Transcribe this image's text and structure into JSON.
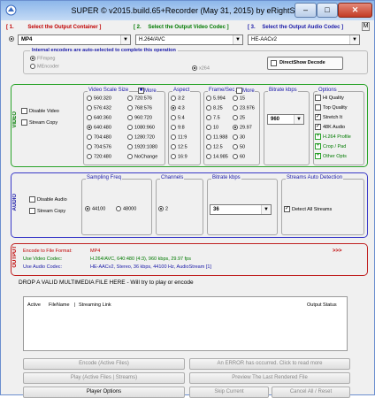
{
  "window": {
    "title": "SUPER © v2015.build.65+Recorder (May 31, 2015) by eRightSoft",
    "minimize": "–",
    "maximize": "□",
    "close": "✕",
    "m_label": "M"
  },
  "selectors": {
    "container_label": "[ 1.",
    "container_title": "Select the Output Container ]",
    "container_value": "MP4",
    "video_label": "[ 2.",
    "video_title": "Select the Output Video Codec ]",
    "video_value": "H.264/AVC",
    "audio_label": "[ 3.",
    "audio_title": "Select the Output Audio Codec ]",
    "audio_value": "HE-AACv2"
  },
  "encoders": {
    "note": "Internal encoders are auto-selected to complete this operation",
    "ffmpeg": "FFmpeg",
    "mencoder": "MEncoder",
    "x264": "x264",
    "directshow": "DirectShow Decode"
  },
  "video": {
    "section": "VIDEO",
    "disable_video": "Disable Video",
    "stream_copy": "Stream Copy",
    "scale_title": "Video Scale Size",
    "more": "More",
    "sizes_col1": [
      "560:320",
      "576:432",
      "640:360",
      "640:480",
      "704:480",
      "704:576",
      "720:480"
    ],
    "sizes_col2": [
      "720:576",
      "768:576",
      "960:720",
      "1080:960",
      "1280:720",
      "1920:1080",
      "NoChange"
    ],
    "aspect_title": "Aspect",
    "aspects": [
      "3:2",
      "4:3",
      "5:4",
      "9:8",
      "11:9",
      "12:5",
      "16:9"
    ],
    "frame_title": "Frame/Sec",
    "fps_col1": [
      "5.994",
      "8.25",
      "7.5",
      "10",
      "11.988",
      "12.5",
      "14.985"
    ],
    "fps_col2": [
      "15",
      "23.976",
      "25",
      "29.97",
      "30",
      "50",
      "60"
    ],
    "bitrate_title": "Bitrate  kbps",
    "bitrate_value": "960",
    "options_title": "Options",
    "options": [
      "Hi Quality",
      "Top Quality",
      "Stretch It",
      "48K Audio",
      "H.264 Profile",
      "Crop / Pad",
      "Other Opts"
    ]
  },
  "audio": {
    "section": "AUDIO",
    "disable_audio": "Disable Audio",
    "stream_copy": "Stream Copy",
    "sampling_title": "Sampling Freq",
    "freq1": "44100",
    "freq2": "48000",
    "channels_title": "Channels",
    "channel": "2",
    "bitrate_title": "Bitrate  kbps",
    "bitrate_value": "36",
    "detection_title": "Streams Auto Detection",
    "detect_all": "Detect All Streams"
  },
  "output": {
    "section": "OUTPUT",
    "line1_label": "Encode to File Format:",
    "line1_value": "MP4",
    "line2_label": "Use Video Codec:",
    "line2_value": "H.264/AVC,  640:480 (4:3),  960 kbps,  29.97 fps",
    "line3_label": "Use Audio Codec:",
    "line3_value": "HE-AACv2,  Stereo,  36 kbps,  44100 Hz,  AudioStream [1]",
    "expand": ">>>"
  },
  "drop_text": "DROP A VALID MULTIMEDIA FILE HERE - Will try to play or encode",
  "filelist": {
    "col_active": "Active",
    "col_filename": "FileName",
    "col_streaming": "Streaming Link",
    "col_status": "Output Status"
  },
  "buttons": {
    "encode": "Encode (Active Files)",
    "error": "An ERROR has occurred. Click to read more",
    "play": "Play (Active Files | Streams)",
    "preview": "Preview  The Last Rendered File",
    "player_options": "Player Options",
    "skip": "Skip Current",
    "cancel": "Cancel All  /  Reset"
  }
}
